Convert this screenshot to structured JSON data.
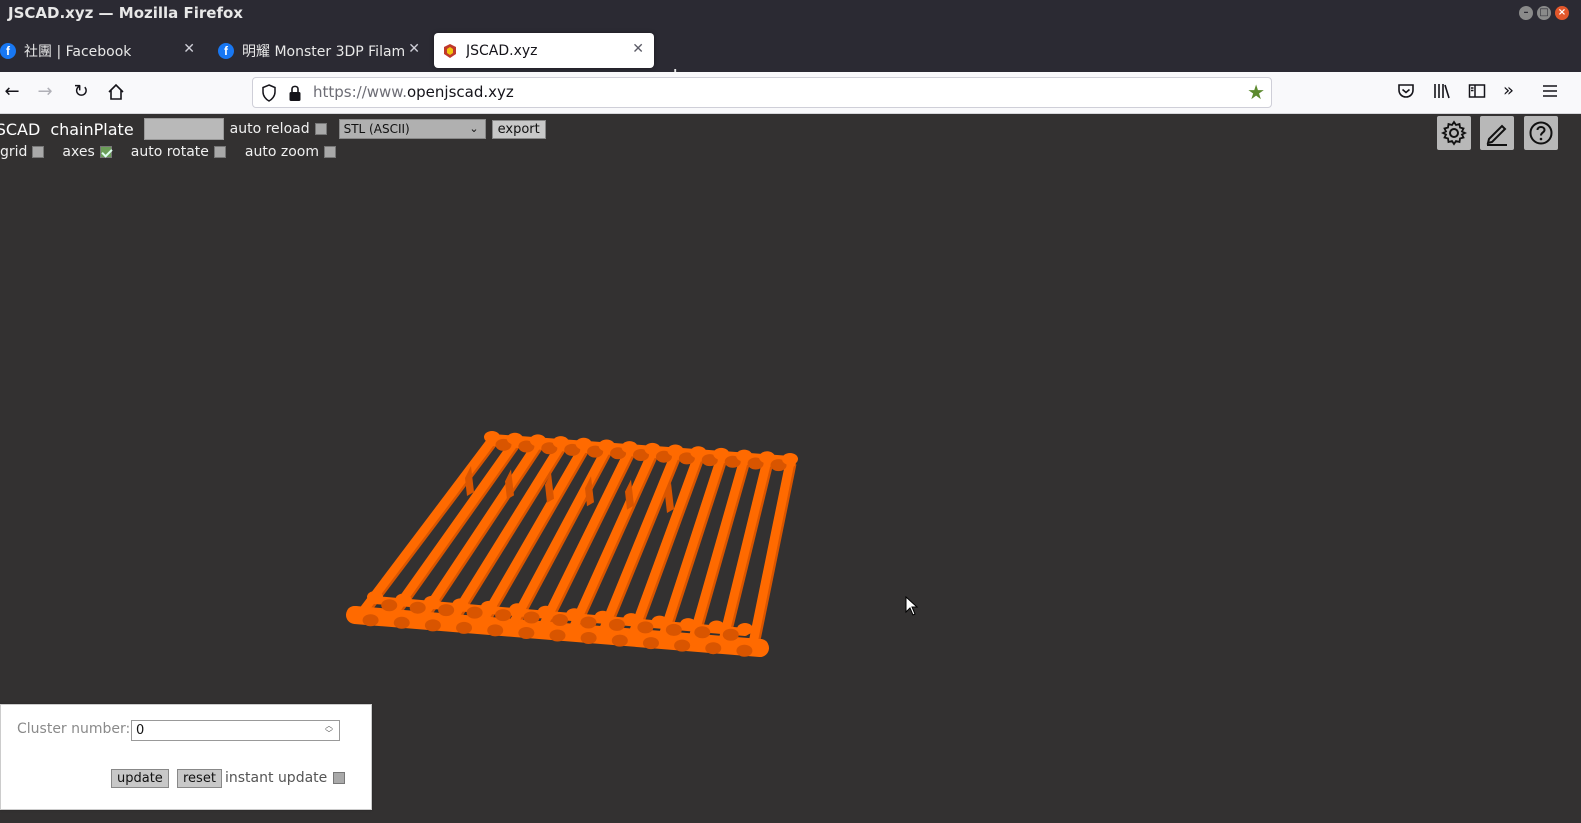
{
  "window": {
    "title": "JSCAD.xyz — Mozilla Firefox"
  },
  "tabs": [
    {
      "label": "社團 | Facebook",
      "icon": "facebook-icon"
    },
    {
      "label": "明耀 Monster 3DP Filam",
      "icon": "facebook-icon"
    },
    {
      "label": "JSCAD.xyz",
      "icon": "jscad-logo-icon",
      "active": true
    }
  ],
  "urlbar": {
    "prefix": "https://www.",
    "domain": "openjscad.xyz"
  },
  "toolbar": {
    "brand": "JSCAD",
    "design_name": "chainPlate",
    "auto_reload_label": "auto reload",
    "format_selected": "STL (ASCII)",
    "export_label": "export",
    "grid_label": "grid",
    "axes_label": "axes",
    "axes_checked": true,
    "auto_rotate_label": "auto rotate",
    "auto_zoom_label": "auto zoom"
  },
  "params": {
    "cluster_label": "Cluster number:",
    "cluster_value": "0",
    "update_label": "update",
    "reset_label": "reset",
    "instant_update_label": "instant update"
  },
  "colors": {
    "viewer_bg": "#333131",
    "model_orange": "#ff6a00",
    "chrome_dark": "#2b2a33",
    "bookmark_star": "#5d8a2f"
  }
}
